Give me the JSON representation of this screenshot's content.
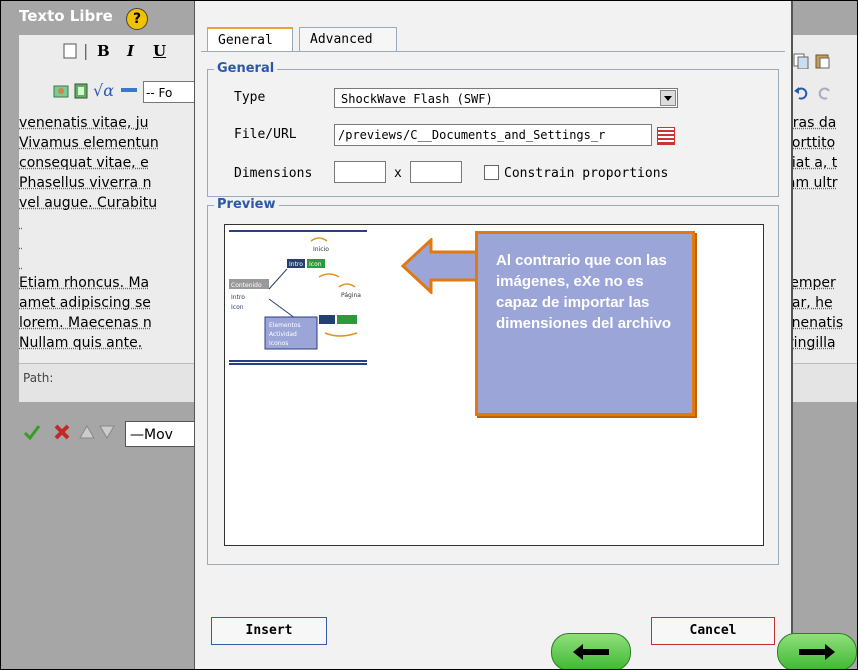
{
  "editor": {
    "title": "Texto Libre",
    "help_glyph": "?",
    "toolbar": {
      "bold": "B",
      "italic": "I",
      "underline": "U",
      "format_fragment": "-- Fo"
    },
    "left_lines": [
      "venenatis vitae, ju",
      "Vivamus elementun",
      "consequat vitae, e",
      "Phasellus viverra n",
      "vel augue. Curabitu",
      "",
      "",
      "",
      "Etiam rhoncus. Ma",
      "amet adipiscing se",
      "lorem. Maecenas n",
      "Nullam quis ante."
    ],
    "right_lines": [
      "Cras da",
      "porttito",
      "giat a, t",
      "iam ultr",
      "",
      "",
      "",
      "",
      "semper",
      "nar, he",
      "enenatis",
      "fringilla"
    ],
    "path_label": "Path:",
    "move_select": "—Mov"
  },
  "dialog": {
    "tabs": [
      {
        "label": "General"
      },
      {
        "label": "Advanced"
      }
    ],
    "general": {
      "legend": "General",
      "type_label": "Type",
      "type_value": "ShockWave Flash (SWF)",
      "file_label": "File/URL",
      "file_value": "/previews/C__Documents_and_Settings_r",
      "dimensions_label": "Dimensions",
      "width_value": "",
      "times_glyph": "x",
      "height_value": "",
      "constrain_label": "Constrain proportions",
      "constrain_checked": false
    },
    "preview": {
      "legend": "Preview",
      "thumb_labels": [
        "Inicio",
        "Intro",
        "Icon",
        "Página",
        "Contenido",
        "Intro",
        "Icon",
        "Elementos",
        "Actividad",
        "Iconos"
      ]
    },
    "callout": {
      "text": "Al contrario que con las imágenes, eXe no es capaz de importar las dimensiones del archivo"
    },
    "buttons": {
      "insert": "Insert",
      "cancel": "Cancel"
    }
  },
  "colors": {
    "accent_orange": "#f0a030",
    "legend_blue": "#2b58a8",
    "callout_fill": "#9ba5d8",
    "nav_green": "#4fc23f"
  }
}
